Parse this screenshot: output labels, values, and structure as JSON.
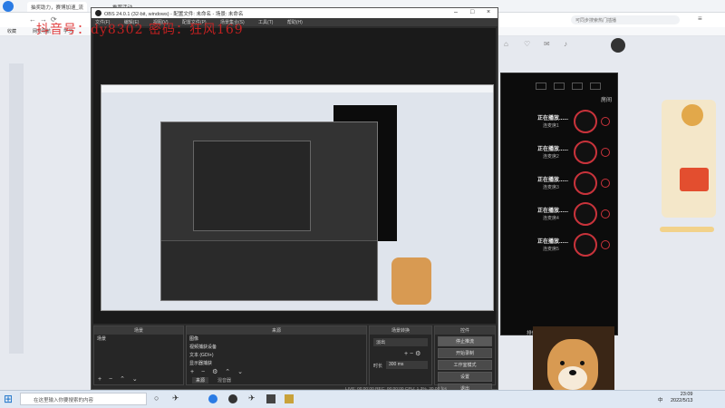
{
  "overlay": {
    "text": "抖音号：dy8302  密码：狂风169"
  },
  "browser": {
    "tabs": [
      "抽奖助力，赛博加速_流",
      "推荐活动"
    ],
    "active_tab": "抽奖助力，赛博加速_流",
    "bookmarks": [
      "收藏",
      "网址导航",
      "学习"
    ],
    "search_placeholder": "可同步搜索热门插播"
  },
  "obs": {
    "title": "OBS 24.0.1 (32-bit, windows) - 配置文件: 未命名 - 场景: 未命名",
    "menu": [
      "文件(F)",
      "编辑(E)",
      "视图(V)",
      "配置文件(P)",
      "场景集合(S)",
      "工具(T)",
      "帮助(H)"
    ],
    "docks": {
      "scenes": {
        "title": "场景",
        "items": [
          "场景"
        ]
      },
      "sources": {
        "title": "来源",
        "items": [
          "图像",
          "视频捕获设备",
          "文本 (GDI+)",
          "显示器捕获"
        ],
        "tabs": [
          "来源",
          "混音器"
        ]
      },
      "transitions": {
        "title": "场景转换",
        "type": "淡出",
        "duration_label": "时长",
        "duration": "300 ms"
      },
      "controls": {
        "title": "控件",
        "buttons": [
          "停止推流",
          "开始录制",
          "工作室模式",
          "设置",
          "退出"
        ]
      }
    },
    "status": "LIVE: 00:00:00   REC: 00:00:00   CPU: 1.3%, 30.00 fps"
  },
  "mic_panel": {
    "header": "房间",
    "rows": [
      {
        "status": "正在播放......",
        "name": "连麦席1"
      },
      {
        "status": "正在播放......",
        "name": "连麦席2"
      },
      {
        "status": "正在播放......",
        "name": "连麦席3"
      },
      {
        "status": "正在播放......",
        "name": "连麦席4"
      },
      {
        "status": "正在播放......",
        "name": "连麦席5"
      }
    ],
    "footer": "排位赛"
  },
  "taskbar": {
    "search_placeholder": "在这里输入你要搜索的内容",
    "time": "23:09",
    "date": "2022/5/13",
    "lang": "中"
  }
}
